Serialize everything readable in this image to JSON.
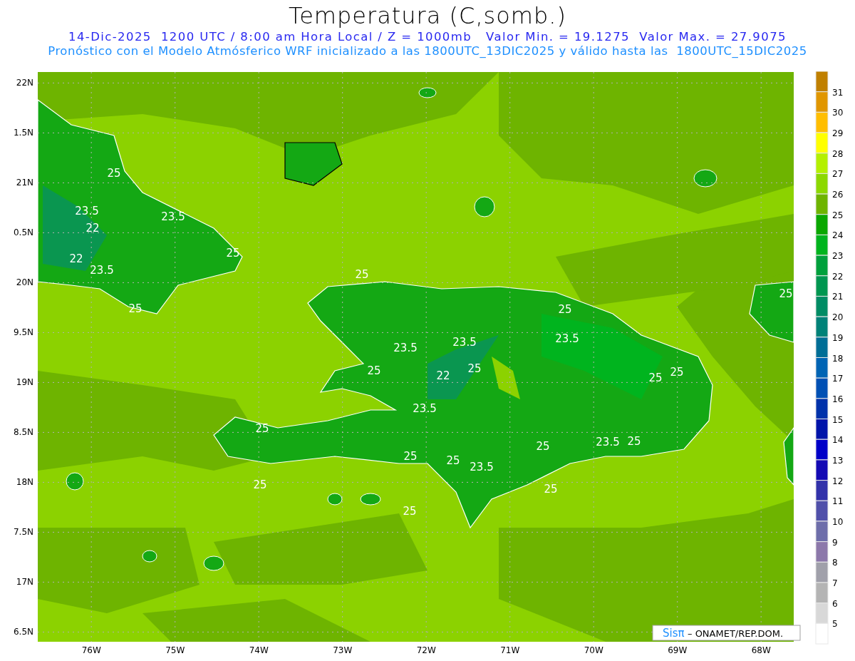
{
  "title": "Temperatura (C,somb.)",
  "subtitle": "14-Dic-2025  1200 UTC / 8:00 am Hora Local / Z = 1000mb   Valor Min. = 19.1275  Valor Max. = 27.9075",
  "description": "Pronóstico con el Modelo Atmósferico WRF inicializado a las 1800UTC_13DIC2025 y válido hasta las  1800UTC_15DIC2025",
  "map": {
    "lat_ticks": [
      "22N",
      "1.5N",
      "21N",
      "0.5N",
      "20N",
      "9.5N",
      "19N",
      "8.5N",
      "18N",
      "7.5N",
      "17N",
      "6.5N"
    ],
    "lon_ticks": [
      "76W",
      "75W",
      "74W",
      "73W",
      "72W",
      "71W",
      "70W",
      "69W",
      "68W"
    ],
    "contour_labels": [
      "25",
      "23.5",
      "22",
      "23.5",
      "25",
      "22",
      "23.5",
      "25",
      "25",
      "25",
      "25",
      "23.5",
      "23.5",
      "23.5",
      "25",
      "25",
      "22",
      "25",
      "25",
      "23.5",
      "25",
      "23.5",
      "25",
      "25",
      "25",
      "25",
      "23.5",
      "25",
      "25",
      "25"
    ]
  },
  "colorbar": {
    "bins": [
      {
        "color": "#c08000"
      },
      {
        "color": "#e09600"
      },
      {
        "color": "#ffbe00"
      },
      {
        "color": "#ffff00"
      },
      {
        "color": "#b4f000"
      },
      {
        "color": "#8cd800"
      },
      {
        "color": "#6eb400"
      },
      {
        "color": "#0aa800"
      },
      {
        "color": "#00b41e"
      },
      {
        "color": "#00a03c"
      },
      {
        "color": "#009650"
      },
      {
        "color": "#008c64"
      },
      {
        "color": "#008278"
      },
      {
        "color": "#006e96"
      },
      {
        "color": "#0064b4"
      },
      {
        "color": "#0050b4"
      },
      {
        "color": "#0032aa"
      },
      {
        "color": "#0014aa"
      },
      {
        "color": "#0000c8"
      },
      {
        "color": "#140ab4"
      },
      {
        "color": "#3232aa"
      },
      {
        "color": "#5050aa"
      },
      {
        "color": "#6e6eaa"
      },
      {
        "color": "#8c78aa"
      },
      {
        "color": "#a0a0aa"
      },
      {
        "color": "#b4b4b4"
      },
      {
        "color": "#d8d8d8"
      },
      {
        "color": "#ffffff"
      }
    ],
    "labels": [
      "31",
      "30",
      "29",
      "28",
      "27",
      "26",
      "25",
      "24",
      "23",
      "22",
      "21",
      "20",
      "19",
      "18",
      "17",
      "16",
      "15",
      "14",
      "13",
      "12",
      "11",
      "10",
      "9",
      "8",
      "7",
      "6",
      "5"
    ]
  },
  "credit": {
    "brand": "Sisπ",
    "text": "– ONAMET/REP.DOM."
  }
}
